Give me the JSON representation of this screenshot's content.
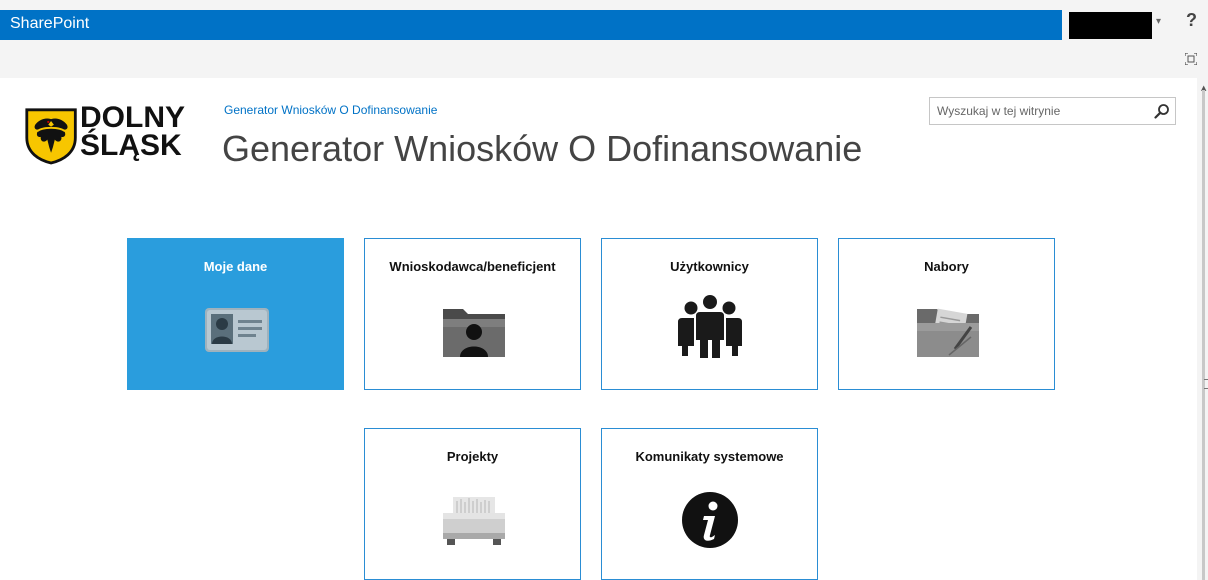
{
  "suite_bar": {
    "brand": "SharePoint",
    "help_label": "?",
    "user_caret": "▾"
  },
  "header": {
    "logo_line1": "DOLNY",
    "logo_line2": "ŚLĄSK",
    "breadcrumb": "Generator Wniosków O Dofinansowanie",
    "title": "Generator Wniosków O Dofinansowanie"
  },
  "search": {
    "placeholder": "Wyszukaj w tej witrynie"
  },
  "tiles": [
    {
      "label": "Moje dane",
      "icon": "id-card-icon",
      "selected": true
    },
    {
      "label": "Wnioskodawca/beneficjent",
      "icon": "person-folder-icon"
    },
    {
      "label": "Użytkownicy",
      "icon": "users-group-icon"
    },
    {
      "label": "Nabory",
      "icon": "document-folder-icon"
    },
    {
      "label": "Projekty",
      "icon": "file-cabinet-icon"
    },
    {
      "label": "Komunikaty systemowe",
      "icon": "info-icon"
    }
  ],
  "colors": {
    "suite_bar": "#0072c6",
    "tile_border": "#2a8dd4",
    "tile_selected": "#2a9ddd",
    "breadcrumb_link": "#0072c6"
  }
}
